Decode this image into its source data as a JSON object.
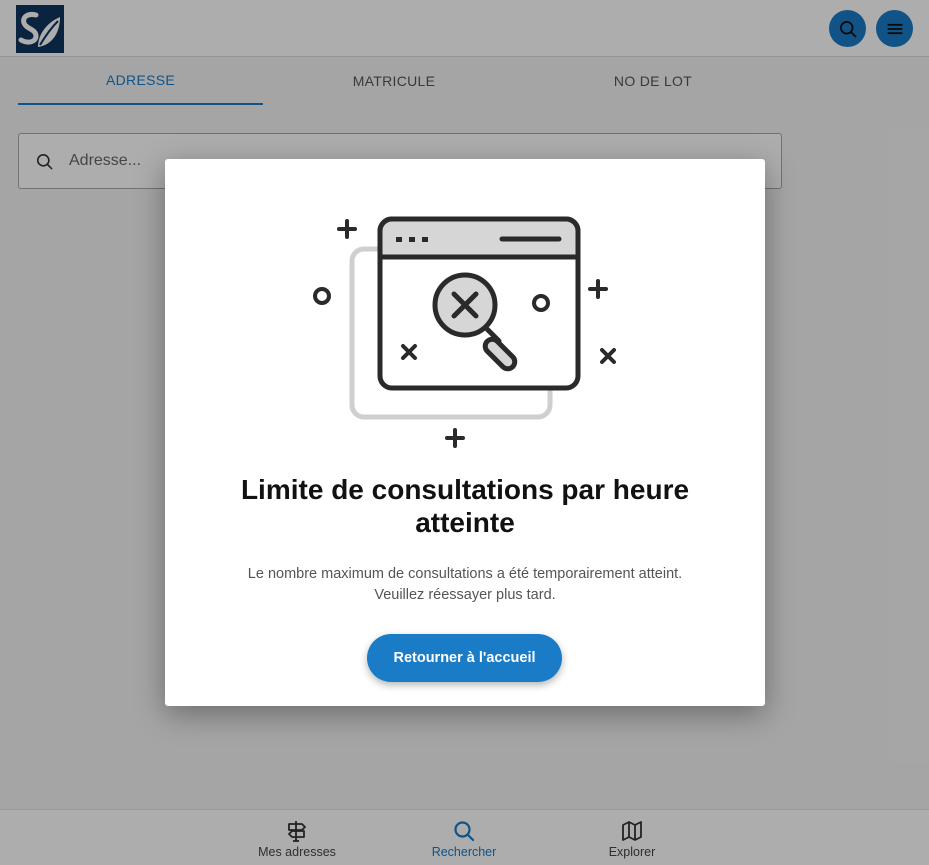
{
  "header": {
    "logo_icon": "sd-leaf-logo",
    "search_button_icon": "search-icon",
    "menu_button_icon": "hamburger-menu-icon"
  },
  "tabs": [
    {
      "label": "ADRESSE",
      "active": true
    },
    {
      "label": "MATRICULE",
      "active": false
    },
    {
      "label": "NO DE LOT",
      "active": false
    }
  ],
  "search": {
    "placeholder": "Adresse...",
    "value": ""
  },
  "modal": {
    "title": "Limite de consultations par heure atteinte",
    "message_line1": "Le nombre maximum de consultations a été temporairement atteint.",
    "message_line2": "Veuillez réessayer plus tard.",
    "button_label": "Retourner à l'accueil",
    "illustration": "browser-search-error-icon"
  },
  "bottom_nav": [
    {
      "label": "Mes adresses",
      "icon": "signpost-icon",
      "active": false
    },
    {
      "label": "Rechercher",
      "icon": "search-icon",
      "active": true
    },
    {
      "label": "Explorer",
      "icon": "map-icon",
      "active": false
    }
  ],
  "colors": {
    "accent": "#1a7bc6",
    "logo_bg": "#10365e",
    "overlay": "rgba(0,0,0,0.32)"
  }
}
